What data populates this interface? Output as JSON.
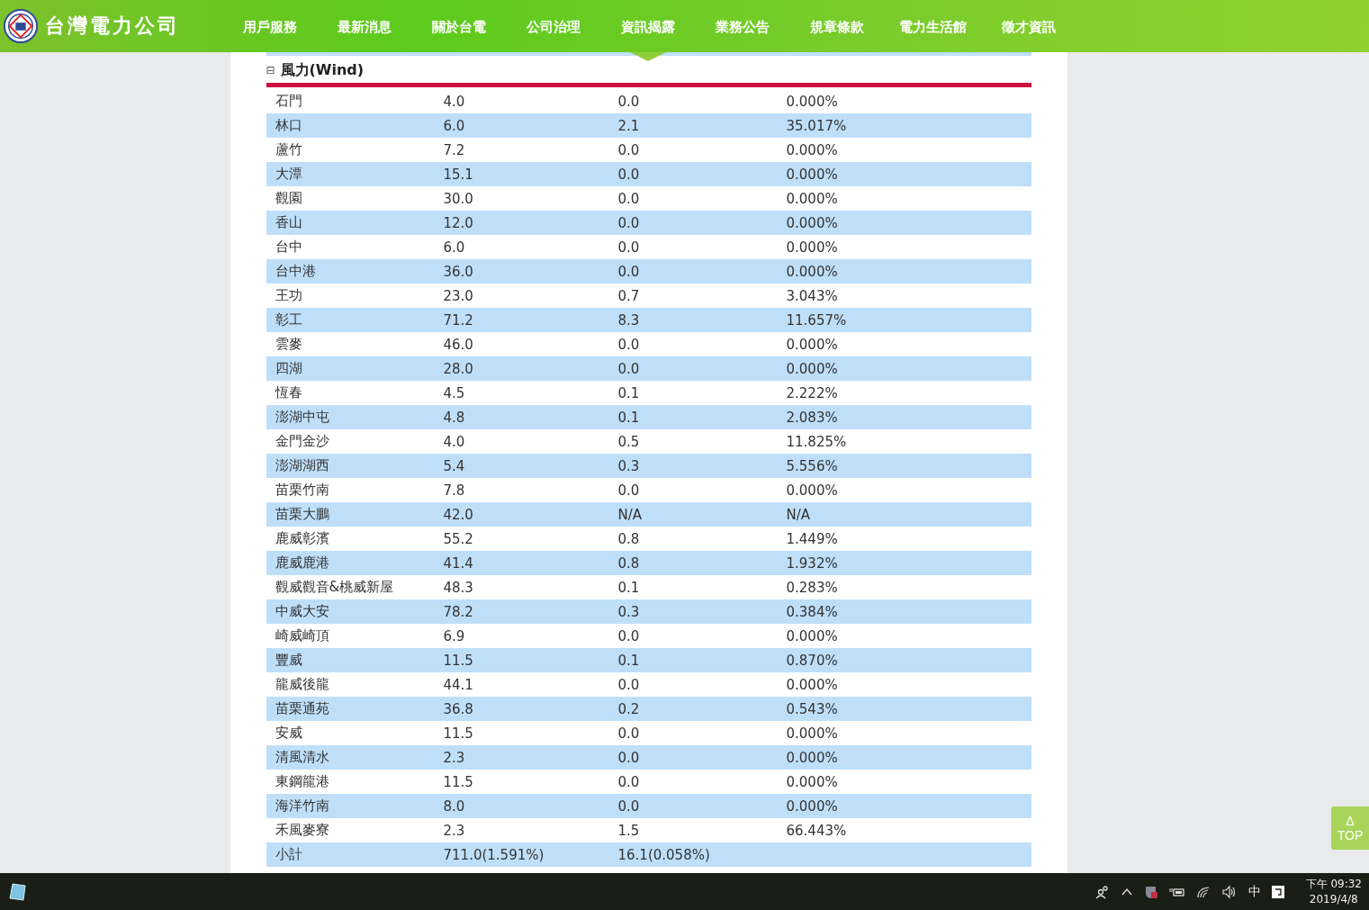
{
  "header": {
    "logo_text": "台灣電力公司",
    "nav": [
      {
        "label": "用戶服務",
        "selected": false
      },
      {
        "label": "最新消息",
        "selected": false
      },
      {
        "label": "關於台電",
        "selected": false
      },
      {
        "label": "公司治理",
        "selected": false
      },
      {
        "label": "資訊揭露",
        "selected": true
      },
      {
        "label": "業務公告",
        "selected": false
      },
      {
        "label": "規章條款",
        "selected": false
      },
      {
        "label": "電力生活館",
        "selected": false
      },
      {
        "label": "徵才資訊",
        "selected": false
      }
    ]
  },
  "section": {
    "toggle": "⊟",
    "title": "風力(Wind)",
    "expanded": true,
    "rows": [
      {
        "name": "石門",
        "column_2": "4.0",
        "column_3": "0.0",
        "column_4": "0.000%"
      },
      {
        "name": "林口",
        "column_2": "6.0",
        "column_3": "2.1",
        "column_4": "35.017%"
      },
      {
        "name": "蘆竹",
        "column_2": "7.2",
        "column_3": "0.0",
        "column_4": "0.000%"
      },
      {
        "name": "大潭",
        "column_2": "15.1",
        "column_3": "0.0",
        "column_4": "0.000%"
      },
      {
        "name": "觀園",
        "column_2": "30.0",
        "column_3": "0.0",
        "column_4": "0.000%"
      },
      {
        "name": "香山",
        "column_2": "12.0",
        "column_3": "0.0",
        "column_4": "0.000%"
      },
      {
        "name": "台中",
        "column_2": "6.0",
        "column_3": "0.0",
        "column_4": "0.000%"
      },
      {
        "name": "台中港",
        "column_2": "36.0",
        "column_3": "0.0",
        "column_4": "0.000%"
      },
      {
        "name": "王功",
        "column_2": "23.0",
        "column_3": "0.7",
        "column_4": "3.043%"
      },
      {
        "name": "彰工",
        "column_2": "71.2",
        "column_3": "8.3",
        "column_4": "11.657%"
      },
      {
        "name": "雲麥",
        "column_2": "46.0",
        "column_3": "0.0",
        "column_4": "0.000%"
      },
      {
        "name": "四湖",
        "column_2": "28.0",
        "column_3": "0.0",
        "column_4": "0.000%"
      },
      {
        "name": "恆春",
        "column_2": "4.5",
        "column_3": "0.1",
        "column_4": "2.222%"
      },
      {
        "name": "澎湖中屯",
        "column_2": "4.8",
        "column_3": "0.1",
        "column_4": "2.083%"
      },
      {
        "name": "金門金沙",
        "column_2": "4.0",
        "column_3": "0.5",
        "column_4": "11.825%"
      },
      {
        "name": "澎湖湖西",
        "column_2": "5.4",
        "column_3": "0.3",
        "column_4": "5.556%"
      },
      {
        "name": "苗栗竹南",
        "column_2": "7.8",
        "column_3": "0.0",
        "column_4": "0.000%"
      },
      {
        "name": "苗栗大鵬",
        "column_2": "42.0",
        "column_3": "N/A",
        "column_4": "N/A"
      },
      {
        "name": "鹿威彰濱",
        "column_2": "55.2",
        "column_3": "0.8",
        "column_4": "1.449%"
      },
      {
        "name": "鹿威鹿港",
        "column_2": "41.4",
        "column_3": "0.8",
        "column_4": "1.932%"
      },
      {
        "name": "觀威觀音&桃威新屋",
        "column_2": "48.3",
        "column_3": "0.1",
        "column_4": "0.283%"
      },
      {
        "name": "中威大安",
        "column_2": "78.2",
        "column_3": "0.3",
        "column_4": "0.384%"
      },
      {
        "name": "崎威崎頂",
        "column_2": "6.9",
        "column_3": "0.0",
        "column_4": "0.000%"
      },
      {
        "name": "豐威",
        "column_2": "11.5",
        "column_3": "0.1",
        "column_4": "0.870%"
      },
      {
        "name": "龍威後龍",
        "column_2": "44.1",
        "column_3": "0.0",
        "column_4": "0.000%"
      },
      {
        "name": "苗栗通苑",
        "column_2": "36.8",
        "column_3": "0.2",
        "column_4": "0.543%"
      },
      {
        "name": "安威",
        "column_2": "11.5",
        "column_3": "0.0",
        "column_4": "0.000%"
      },
      {
        "name": "清風清水",
        "column_2": "2.3",
        "column_3": "0.0",
        "column_4": "0.000%"
      },
      {
        "name": "東鋼龍港",
        "column_2": "11.5",
        "column_3": "0.0",
        "column_4": "0.000%"
      },
      {
        "name": "海洋竹南",
        "column_2": "8.0",
        "column_3": "0.0",
        "column_4": "0.000%"
      },
      {
        "name": "禾風麥寮",
        "column_2": "2.3",
        "column_3": "1.5",
        "column_4": "66.443%"
      },
      {
        "name": "小計",
        "column_2": "711.0(1.591%)",
        "column_3": "16.1(0.058%)"
      }
    ]
  },
  "top_button": {
    "arrow": "Δ",
    "label": "TOP"
  },
  "taskbar": {
    "ime": "中",
    "time": "下午 09:32",
    "date": "2019/4/8"
  }
}
